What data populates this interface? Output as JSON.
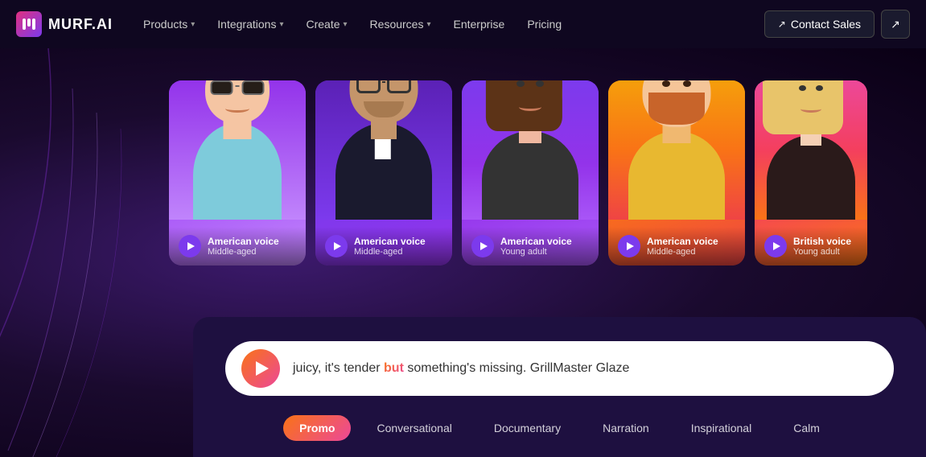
{
  "navbar": {
    "logo_text": "MURF.AI",
    "logo_letter": "M",
    "nav_items": [
      {
        "label": "Products",
        "has_dropdown": true
      },
      {
        "label": "Integrations",
        "has_dropdown": true
      },
      {
        "label": "Create",
        "has_dropdown": true
      },
      {
        "label": "Resources",
        "has_dropdown": true
      },
      {
        "label": "Enterprise",
        "has_dropdown": false
      },
      {
        "label": "Pricing",
        "has_dropdown": false
      }
    ],
    "contact_sales_label": "Contact Sales",
    "contact_arrow": "↗"
  },
  "voice_cards": [
    {
      "id": 1,
      "voice_type": "American voice",
      "age": "Middle-aged",
      "card_class": "card-1"
    },
    {
      "id": 2,
      "voice_type": "American voice",
      "age": "Middle-aged",
      "card_class": "card-2"
    },
    {
      "id": 3,
      "voice_type": "American voice",
      "age": "Young adult",
      "card_class": "card-3"
    },
    {
      "id": 4,
      "voice_type": "American voice",
      "age": "Middle-aged",
      "card_class": "card-4"
    },
    {
      "id": 5,
      "voice_type": "British voice",
      "age": "Young adult",
      "card_class": "card-5"
    }
  ],
  "player": {
    "text_before": "juicy, it's tender ",
    "text_highlight": "but",
    "text_after": " something's missing. GrillMaster Glaze"
  },
  "style_tabs": [
    {
      "label": "Promo",
      "active": true
    },
    {
      "label": "Conversational",
      "active": false
    },
    {
      "label": "Documentary",
      "active": false
    },
    {
      "label": "Narration",
      "active": false
    },
    {
      "label": "Inspirational",
      "active": false
    },
    {
      "label": "Calm",
      "active": false
    }
  ]
}
